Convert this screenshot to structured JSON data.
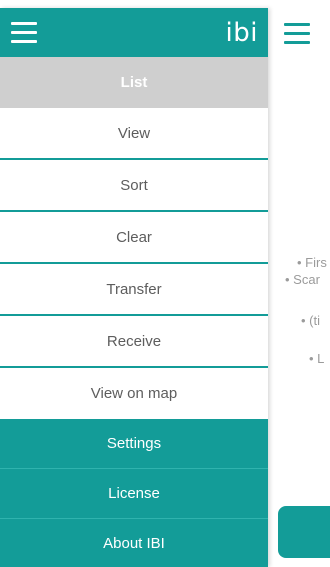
{
  "app": {
    "brand": "ibi",
    "colors": {
      "accent": "#139c98",
      "selected_bg": "#cfcfcf",
      "text_gray": "#5d5d5d"
    }
  },
  "drawer": {
    "menu_icon": "hamburger-icon",
    "items": [
      {
        "label": "List",
        "state": "selected"
      },
      {
        "label": "View"
      },
      {
        "label": "Sort"
      },
      {
        "label": "Clear"
      },
      {
        "label": "Transfer"
      },
      {
        "label": "Receive"
      },
      {
        "label": "View on map"
      },
      {
        "label": "Settings"
      },
      {
        "label": "License"
      },
      {
        "label": "About IBI"
      }
    ]
  },
  "underlay": {
    "menu_icon": "hamburger-icon",
    "text_fragments": [
      "• Firs",
      "• Scar",
      "• (ti",
      "• L"
    ]
  }
}
